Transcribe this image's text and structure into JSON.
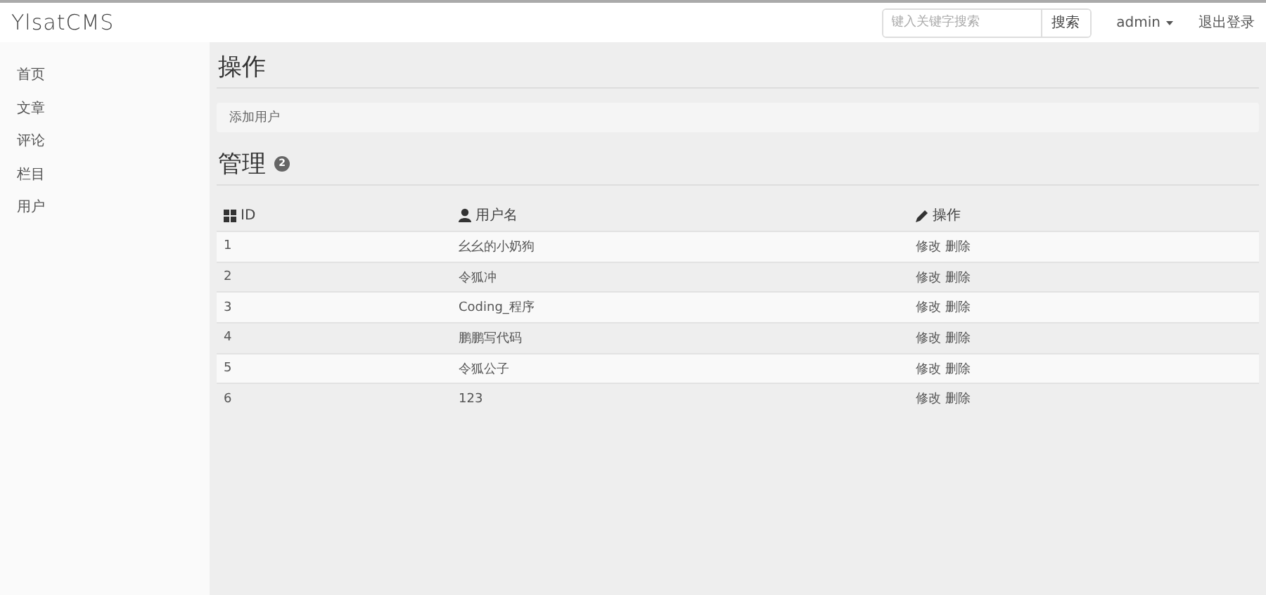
{
  "brand": "YlsatCMS",
  "search": {
    "placeholder": "键入关键字搜索",
    "button": "搜索"
  },
  "user_menu": "admin",
  "logout": "退出登录",
  "sidebar": {
    "items": [
      {
        "label": "首页"
      },
      {
        "label": "文章"
      },
      {
        "label": "评论"
      },
      {
        "label": "栏目"
      },
      {
        "label": "用户"
      }
    ]
  },
  "actions_heading": "操作",
  "actions": [
    {
      "label": "添加用户"
    }
  ],
  "manage_heading": "管理",
  "manage_count": "2",
  "table": {
    "columns": [
      {
        "label": "ID",
        "kind": "grid"
      },
      {
        "label": "用户名",
        "kind": "user"
      },
      {
        "label": "操作",
        "kind": "pencil"
      }
    ],
    "rows": [
      {
        "id": "1",
        "name": "幺幺的小奶狗",
        "links": [
          "修改",
          "删除"
        ]
      },
      {
        "id": "2",
        "name": "令狐冲",
        "links": [
          "修改",
          "删除"
        ]
      },
      {
        "id": "3",
        "name": "Coding_程序",
        "links": [
          "修改",
          "删除"
        ]
      },
      {
        "id": "4",
        "name": "鹏鹏写代码",
        "links": [
          "修改",
          "删除"
        ]
      },
      {
        "id": "5",
        "name": "令狐公子",
        "links": [
          "修改",
          "删除"
        ]
      },
      {
        "id": "6",
        "name": "123",
        "links": [
          "修改",
          "删除"
        ]
      }
    ]
  }
}
